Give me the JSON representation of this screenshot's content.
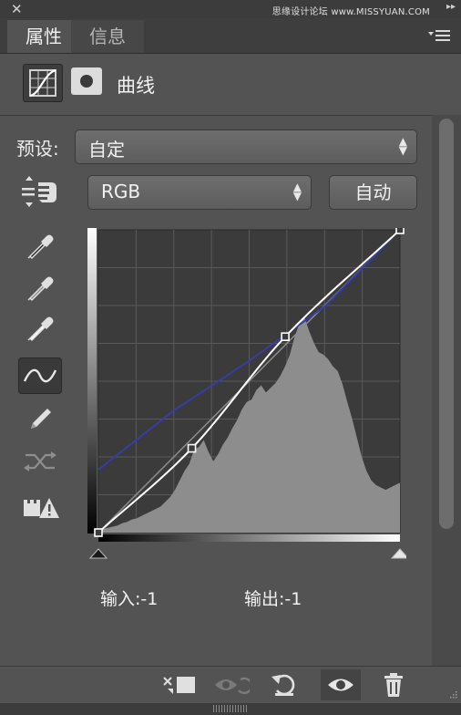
{
  "window": {
    "close_glyph": "✕",
    "watermark": "思缘设计论坛 www.MISSYUAN.COM",
    "collapse_glyph": "▸▸"
  },
  "tabs": [
    {
      "label": "属性",
      "active": true
    },
    {
      "label": "信息",
      "active": false
    }
  ],
  "header": {
    "title": "曲线",
    "icons": [
      "curves-adjustment-icon",
      "layer-mask-icon"
    ]
  },
  "preset": {
    "label": "预设:",
    "value": "自定"
  },
  "channel": {
    "value": "RGB"
  },
  "auto_button": {
    "label": "自动"
  },
  "tools": [
    "on-image-adjust-icon",
    "black-point-eyedropper-icon",
    "gray-point-eyedropper-icon",
    "white-point-eyedropper-icon",
    "curve-point-tool-icon",
    "pencil-icon",
    "smooth-curve-icon",
    "clipping-warning-icon"
  ],
  "readouts": {
    "input": "输入:-1",
    "output": "输出:-1"
  },
  "curves": {
    "domain": [
      0,
      255
    ],
    "rgb_points": [
      [
        0,
        0
      ],
      [
        79,
        71
      ],
      [
        158,
        165
      ],
      [
        255,
        255
      ]
    ],
    "blue_curve": [
      [
        0,
        53
      ],
      [
        64,
        103
      ],
      [
        128,
        145
      ],
      [
        192,
        191
      ],
      [
        255,
        255
      ]
    ],
    "colors": {
      "rgb": "#ffffff",
      "blue": "#3b3ba8",
      "baseline": "#8c8c8c",
      "histogram": "#8d8d8d",
      "grid": "#5a5a5a",
      "graph_bg": "#3b3b3b"
    },
    "histogram": [
      2,
      3,
      4,
      5,
      6,
      8,
      9,
      11,
      12,
      14,
      16,
      18,
      20,
      22,
      26,
      30,
      36,
      44,
      52,
      58,
      70,
      72,
      78,
      68,
      60,
      66,
      74,
      80,
      88,
      95,
      104,
      110,
      112,
      120,
      124,
      118,
      122,
      126,
      132,
      140,
      150,
      165,
      176,
      182,
      170,
      160,
      152,
      150,
      146,
      140,
      136,
      125,
      110,
      96,
      80,
      64,
      52,
      44,
      40,
      38,
      36,
      38,
      40,
      42
    ]
  },
  "bottom_buttons": [
    "clip-to-layer-icon",
    "view-previous-state-icon",
    "reset-icon",
    "visibility-eye-icon",
    "trash-icon"
  ]
}
